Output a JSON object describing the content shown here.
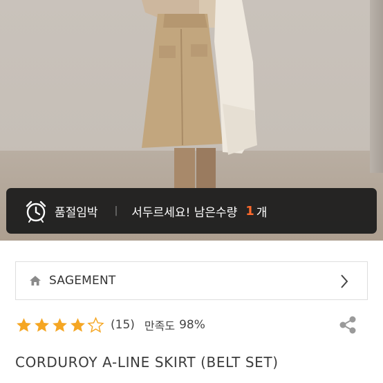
{
  "banner": {
    "tag": "품절임박",
    "divider": "|",
    "message": "서두르세요! 남은수량",
    "count": "1",
    "unit": "개",
    "accent_color": "#ff6a2c",
    "icon": "alarm-clock-icon"
  },
  "brand": {
    "name": "SAGEMENT",
    "icon": "home-icon",
    "chevron": "chevron-right-icon"
  },
  "rating": {
    "stars": 4.5,
    "max_stars": 5,
    "review_count": "(15)",
    "satisfaction_label": "만족도",
    "satisfaction_value": "98%",
    "star_color": "#f5a623",
    "share_icon": "share-icon"
  },
  "product": {
    "title": "CORDUROY A-LINE SKIRT (BELT SET)"
  }
}
